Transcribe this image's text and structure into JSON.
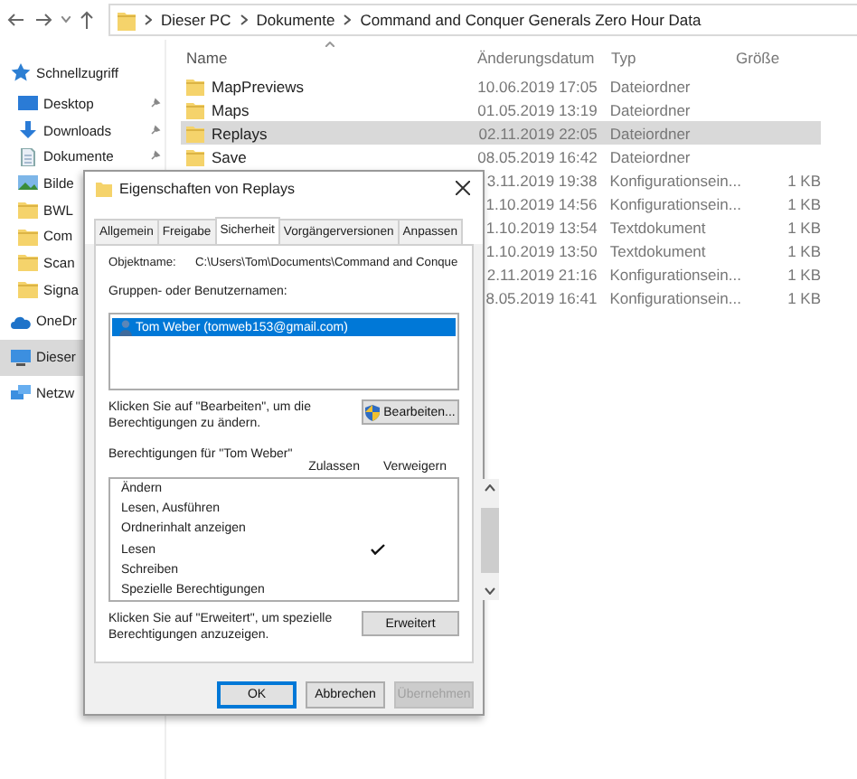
{
  "address_bar": {
    "crumbs": [
      "Dieser PC",
      "Dokumente",
      "Command and Conquer Generals Zero Hour Data"
    ]
  },
  "columns": [
    "Name",
    "Änderungsdatum",
    "Typ",
    "Größe"
  ],
  "sidebar": {
    "items": [
      {
        "label": "Schnellzugriff",
        "kind": "star",
        "selected": false,
        "children": [
          {
            "label": "Desktop",
            "kind": "desktop",
            "pinned": true,
            "selected": false
          },
          {
            "label": "Downloads",
            "kind": "download",
            "pinned": true,
            "selected": false
          },
          {
            "label": "Dokumente",
            "kind": "document",
            "pinned": true,
            "selected": false
          },
          {
            "label": "Bilde",
            "kind": "pictures",
            "pinned": false,
            "selected": false
          },
          {
            "label": "BWL",
            "kind": "folder",
            "pinned": false,
            "selected": false
          },
          {
            "label": "Com",
            "kind": "folder",
            "pinned": false,
            "selected": false
          },
          {
            "label": "Scan",
            "kind": "folder",
            "pinned": false,
            "selected": false
          },
          {
            "label": "Signa",
            "kind": "folder",
            "pinned": false,
            "selected": false
          }
        ]
      },
      {
        "label": "OneDr",
        "kind": "cloud",
        "selected": false
      },
      {
        "label": "Dieser",
        "kind": "pc",
        "selected": true
      },
      {
        "label": "Netzw",
        "kind": "network",
        "selected": false
      }
    ]
  },
  "files": [
    {
      "name": "MapPreviews",
      "date": "10.06.2019 17:05",
      "type": "Dateiordner",
      "selected": false
    },
    {
      "name": "Maps",
      "date": "01.05.2019 13:19",
      "type": "Dateiordner",
      "selected": false
    },
    {
      "name": "Replays",
      "date": "02.11.2019 22:05",
      "type": "Dateiordner",
      "selected": true
    },
    {
      "name": "Save",
      "date": "08.05.2019 16:42",
      "type": "Dateiordner",
      "selected": false
    },
    {
      "date": "3.11.2019 19:38",
      "type": "Konfigurationsein...",
      "size": "1 KB",
      "selected": false
    },
    {
      "date": "1.10.2019 14:56",
      "type": "Konfigurationsein...",
      "size": "1 KB",
      "selected": false
    },
    {
      "date": "1.10.2019 13:54",
      "type": "Textdokument",
      "size": "1 KB",
      "selected": false
    },
    {
      "date": "1.10.2019 13:50",
      "type": "Textdokument",
      "size": "1 KB",
      "selected": false
    },
    {
      "date": "2.11.2019 21:16",
      "type": "Konfigurationsein...",
      "size": "1 KB",
      "selected": false
    },
    {
      "date": "8.05.2019 16:41",
      "type": "Konfigurationsein...",
      "size": "1 KB",
      "selected": false
    }
  ],
  "dialog": {
    "title": "Eigenschaften von Replays",
    "tabs": [
      {
        "label": "Allgemein",
        "selected": false
      },
      {
        "label": "Freigabe",
        "selected": false
      },
      {
        "label": "Sicherheit",
        "selected": true
      },
      {
        "label": "Vorgängerversionen",
        "selected": false
      },
      {
        "label": "Anpassen",
        "selected": false
      }
    ],
    "object_label": "Objektname:",
    "object_value": "C:\\Users\\Tom\\Documents\\Command and Conque",
    "groups_label": "Gruppen- oder Benutzernamen:",
    "users": [
      {
        "name": "Tom Weber (tomweb153@gmail.com)",
        "selected": true
      }
    ],
    "edit_hint": "Klicken Sie auf \"Bearbeiten\", um die Berechtigungen zu ändern.",
    "edit_button": "Bearbeiten...",
    "permissions_label": "Berechtigungen für \"Tom Weber\"",
    "allow_header": "Zulassen",
    "deny_header": "Verweigern",
    "permissions": [
      {
        "name": "Ändern",
        "allow": false,
        "deny": false
      },
      {
        "name": "Lesen, Ausführen",
        "allow": false,
        "deny": false
      },
      {
        "name": "Ordnerinhalt anzeigen",
        "allow": false,
        "deny": false
      },
      {
        "name": "Lesen",
        "allow": true,
        "deny": false
      },
      {
        "name": "Schreiben",
        "allow": false,
        "deny": false
      },
      {
        "name": "Spezielle Berechtigungen",
        "allow": false,
        "deny": false
      }
    ],
    "advanced_hint": "Klicken Sie auf \"Erweitert\", um spezielle Berechtigungen anzuzeigen.",
    "advanced_button": "Erweitert",
    "buttons": [
      {
        "label": "OK",
        "default": true,
        "disabled": false
      },
      {
        "label": "Abbrechen",
        "default": false,
        "disabled": false
      },
      {
        "label": "Übernehmen",
        "default": false,
        "disabled": true
      }
    ]
  }
}
